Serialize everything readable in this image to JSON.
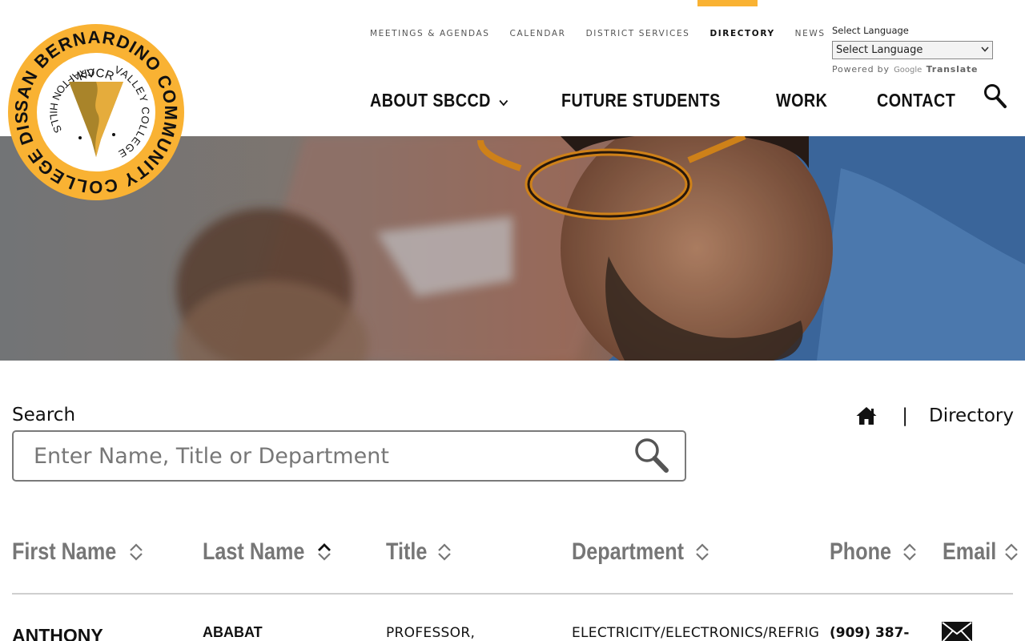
{
  "brand": {
    "logo_ring_text": "SAN BERNARDINO COMMUNITY COLLEGE DISTRICT",
    "logo_inner_top": "KVCR",
    "logo_inner_left": "CRAFTON HILLS",
    "logo_inner_right": "VALLEY COLLEGE",
    "accent": "#F9B233",
    "arrowhead": "#A9842A"
  },
  "utility_nav": {
    "items": [
      {
        "label": "MEETINGS & AGENDAS"
      },
      {
        "label": "CALENDAR"
      },
      {
        "label": "DISTRICT SERVICES"
      },
      {
        "label": "DIRECTORY"
      },
      {
        "label": "NEWS"
      }
    ],
    "active": "DIRECTORY"
  },
  "language": {
    "label": "Select Language",
    "selected": "Select Language",
    "powered_by": "Powered by",
    "google": "Google",
    "translate": "Translate"
  },
  "main_nav": {
    "about": "ABOUT SBCCD",
    "future": "FUTURE STUDENTS",
    "work": "WORK",
    "contact": "CONTACT"
  },
  "search": {
    "label": "Search",
    "placeholder": "Enter Name, Title or Department",
    "value": ""
  },
  "breadcrumb": {
    "separator": "|",
    "current": "Directory"
  },
  "table": {
    "headers": {
      "first_name": "First Name",
      "last_name": "Last Name",
      "title": "Title",
      "department": "Department",
      "phone": "Phone",
      "email": "Email"
    },
    "sorted_column": "last_name",
    "rows": [
      {
        "first_name": "ANTHONY",
        "last_name": "ABABAT",
        "title": "PROFESSOR,",
        "department": "ELECTRICITY/ELECTRONICS/REFRIG",
        "phone": "(909) 387-"
      }
    ]
  }
}
